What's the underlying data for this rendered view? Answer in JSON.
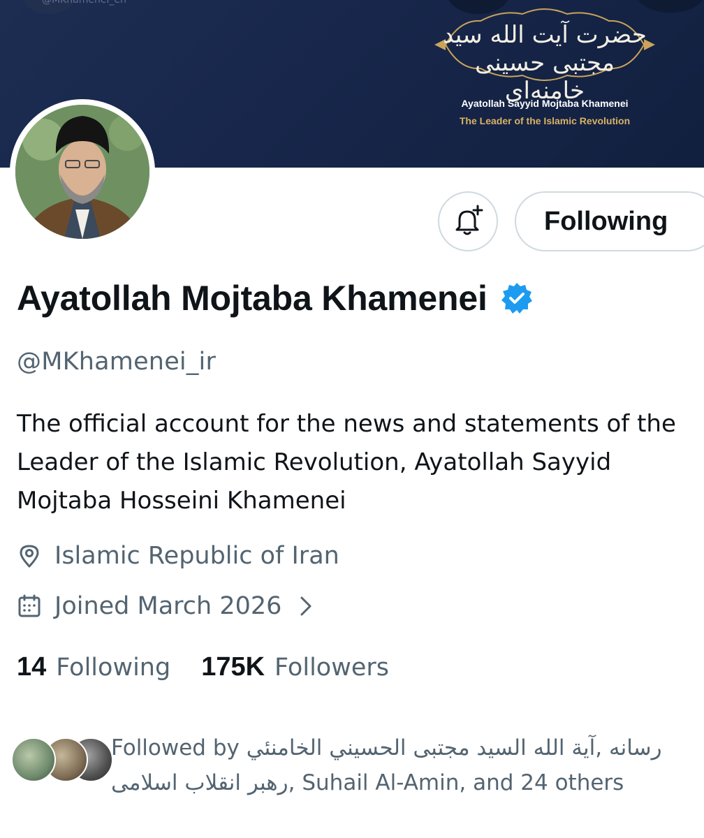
{
  "banner": {
    "handle_text": "@MKhamenei_en",
    "arabic_calligraphy": "حضرت آیت الله سید مجتبی حسینی خامنه‌ای",
    "title": "Ayatollah Sayyid Mojtaba Khamenei",
    "subtitle": "The Leader of the Islamic Revolution"
  },
  "profile": {
    "display_name": "Ayatollah Mojtaba Khamenei",
    "handle": "@MKhamenei_ir",
    "bio": "The official account for the news and statements of the Leader of the Islamic Revolution, Ayatollah Sayyid Mojtaba Hosseini Khamenei",
    "location": "Islamic Republic of Iran",
    "joined": "Joined March 2026"
  },
  "actions": {
    "follow_label": "Following"
  },
  "stats": {
    "following_count": "14",
    "following_label": "Following",
    "followers_count": "175K",
    "followers_label": "Followers"
  },
  "followed_by": {
    "prefix": "Followed by",
    "name1": "آية الله السيد مجتبى الحسيني الخامنئي",
    "sep1": ", ",
    "name2": "رسانه رهبر انقلاب اسلامی",
    "sep2": ", ",
    "name3": "Suhail Al-Amin",
    "suffix": ", and 24 others"
  },
  "colors": {
    "banner_bg": "#17264a",
    "gold": "#d9b265",
    "text_primary": "#0f1419",
    "text_secondary": "#536471",
    "verified_blue": "#1d9bf0",
    "border": "#cfd9de"
  },
  "icons": [
    "bell-plus-icon",
    "verified-badge-icon",
    "location-pin-icon",
    "calendar-icon",
    "chevron-right-icon"
  ]
}
